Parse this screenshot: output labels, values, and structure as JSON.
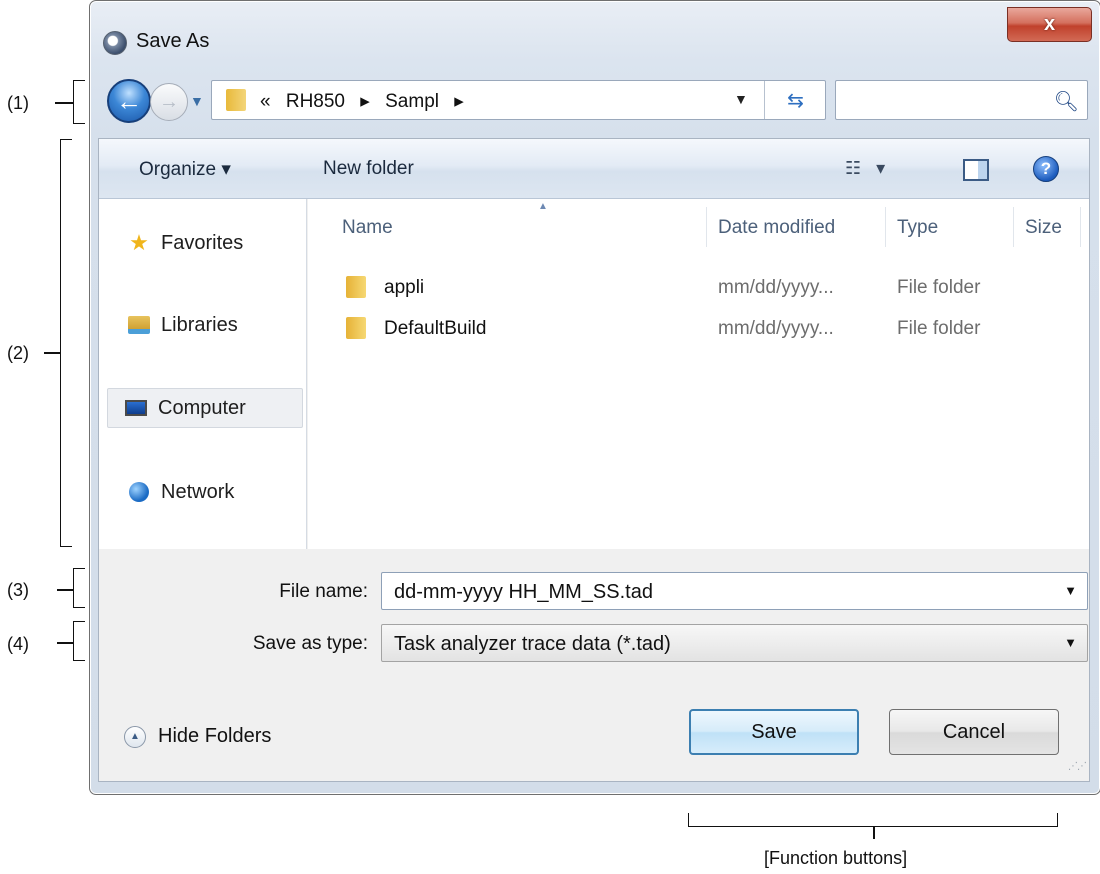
{
  "window": {
    "title": "Save As",
    "close_glyph": "x"
  },
  "nav": {
    "back_icon": "back-arrow-icon",
    "forward_icon": "forward-arrow-icon",
    "breadcrumb": [
      "«",
      "RH850",
      "▸",
      "Sampl",
      "▸"
    ],
    "search_placeholder": ""
  },
  "toolbar": {
    "organize_label": "Organize ▾",
    "new_folder_label": "New folder",
    "views_glyph": "▾"
  },
  "sidebar": {
    "items": [
      {
        "label": "Favorites",
        "icon": "star-icon"
      },
      {
        "label": "Libraries",
        "icon": "libraries-icon"
      },
      {
        "label": "Computer",
        "icon": "computer-icon"
      },
      {
        "label": "Network",
        "icon": "network-icon"
      }
    ]
  },
  "files": {
    "columns": [
      "Name",
      "Date modified",
      "Type",
      "Size"
    ],
    "rows": [
      {
        "name": "appli",
        "date": "mm/dd/yyyy...",
        "type": "File folder",
        "size": ""
      },
      {
        "name": "DefaultBuild",
        "date": "mm/dd/yyyy...",
        "type": "File folder",
        "size": ""
      }
    ]
  },
  "form": {
    "file_name_label": "File name:",
    "file_name_value": "dd-mm-yyyy HH_MM_SS.tad",
    "save_type_label": "Save as type:",
    "save_type_value": "Task analyzer trace data (*.tad)"
  },
  "footer": {
    "hide_folders_label": "Hide Folders",
    "save_label": "Save",
    "cancel_label": "Cancel"
  },
  "annotations": {
    "a1": "(1)",
    "a2": "(2)",
    "a3": "(3)",
    "a4": "(4)",
    "function_buttons": "[Function buttons]"
  },
  "colors": {
    "accent": "#3c7fb1",
    "close_red": "#c0412c",
    "toolbar_blue": "#dde6f1"
  }
}
